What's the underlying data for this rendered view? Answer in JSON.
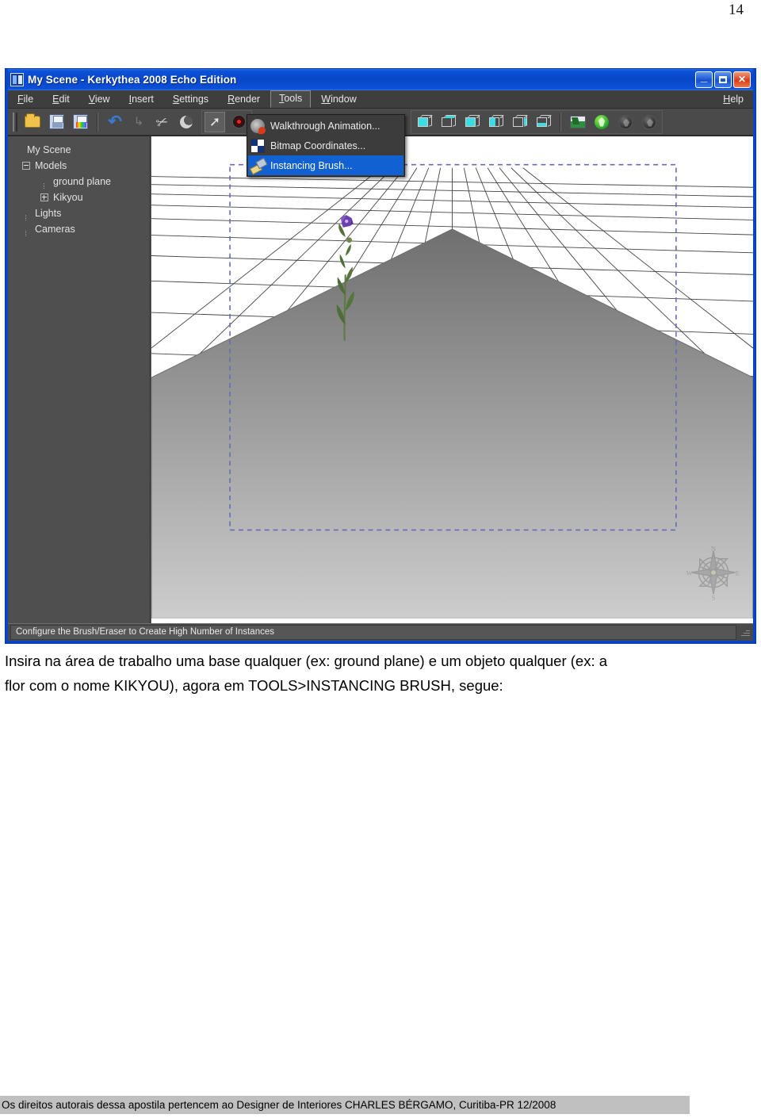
{
  "page": {
    "number": "14"
  },
  "window": {
    "title": "My Scene - Kerkythea 2008 Echo Edition",
    "app_icon": "kerkythea-icon",
    "buttons": {
      "minimize": "_",
      "maximize": "□",
      "close": "✕"
    }
  },
  "menubar": {
    "items": [
      {
        "label": "File",
        "mnemonic": "F",
        "active": false
      },
      {
        "label": "Edit",
        "mnemonic": "E",
        "active": false
      },
      {
        "label": "View",
        "mnemonic": "V",
        "active": false
      },
      {
        "label": "Insert",
        "mnemonic": "I",
        "active": false
      },
      {
        "label": "Settings",
        "mnemonic": "S",
        "active": false
      },
      {
        "label": "Render",
        "mnemonic": "R",
        "active": false
      },
      {
        "label": "Tools",
        "mnemonic": "T",
        "active": true
      },
      {
        "label": "Window",
        "mnemonic": "W",
        "active": false
      }
    ],
    "help": "Help"
  },
  "tools_menu": {
    "open": true,
    "items": [
      {
        "label": "Walkthrough Animation...",
        "icon": "walkthrough-animation-icon",
        "selected": false
      },
      {
        "label": "Bitmap Coordinates...",
        "icon": "bitmap-coordinates-icon",
        "selected": false
      },
      {
        "label": "Instancing Brush...",
        "icon": "instancing-brush-icon",
        "selected": true
      }
    ],
    "highlight_color": "#1261d2"
  },
  "toolbar": {
    "left_buttons": [
      {
        "name": "open-file-button",
        "icon": "folder-icon",
        "pressed": false
      },
      {
        "name": "save-button",
        "icon": "floppy-disk-icon",
        "pressed": false
      },
      {
        "name": "save-as-button",
        "icon": "floppy-color-icon",
        "pressed": false
      },
      {
        "name": "undo-button",
        "icon": "undo-arrow-icon",
        "pressed": false
      },
      {
        "name": "redo-button",
        "icon": "redo-arrow-icon",
        "pressed": false
      },
      {
        "name": "magic-wand-button",
        "icon": "wand-icon",
        "pressed": false
      },
      {
        "name": "material-button",
        "icon": "sphere-icon",
        "pressed": false
      },
      {
        "name": "select-tool-button",
        "icon": "cursor-arrow-icon",
        "pressed": true
      },
      {
        "name": "render-button",
        "icon": "render-target-icon",
        "pressed": false
      }
    ],
    "view_buttons": [
      {
        "name": "view-perspective-button",
        "icon": "cube-perspective-icon"
      },
      {
        "name": "view-top-button",
        "icon": "cube-top-icon"
      },
      {
        "name": "view-front-button",
        "icon": "cube-front-icon"
      },
      {
        "name": "view-back-button",
        "icon": "cube-back-icon"
      },
      {
        "name": "view-left-button",
        "icon": "cube-left-icon"
      },
      {
        "name": "view-right-button",
        "icon": "cube-right-icon"
      }
    ],
    "extra_buttons": [
      {
        "name": "image-preview-button",
        "icon": "image-icon"
      },
      {
        "name": "start-render-button",
        "icon": "green-gear-icon"
      },
      {
        "name": "globe-a-button",
        "icon": "dark-sphere-icon"
      },
      {
        "name": "globe-b-button",
        "icon": "dark-sphere-alt-icon"
      }
    ]
  },
  "sidebar": {
    "tree": [
      {
        "label": "My Scene",
        "level": 1,
        "toggle": "none",
        "name": "tree-node-my-scene"
      },
      {
        "label": "Models",
        "level": 2,
        "toggle": "minus",
        "name": "tree-node-models"
      },
      {
        "label": "ground plane",
        "level": 3,
        "toggle": "stub",
        "name": "tree-node-ground-plane"
      },
      {
        "label": "Kikyou",
        "level": 3,
        "toggle": "plus",
        "name": "tree-node-kikyou"
      },
      {
        "label": "Lights",
        "level": 2,
        "toggle": "stub",
        "name": "tree-node-lights"
      },
      {
        "label": "Cameras",
        "level": 2,
        "toggle": "stub",
        "name": "tree-node-cameras"
      }
    ]
  },
  "viewport": {
    "scene_objects": [
      "ground plane grid",
      "ground plane polygon",
      "Kikyou flower",
      "selection bounds"
    ],
    "compass": "compass-rose-watermark",
    "selection_box_color": "#6a6ab4",
    "ground_fill_color": "#8a8a8a",
    "sky_color": "#ffffff"
  },
  "status_bar": {
    "message": "Configure the Brush/Eraser to Create High Number of Instances"
  },
  "body_copy": {
    "line1": "Insira na área de trabalho uma base qualquer (ex: ground plane) e um objeto qualquer (ex: a",
    "line2": "flor com o nome KIKYOU), agora em TOOLS>INSTANCING BRUSH, segue:"
  },
  "footer": {
    "text": "Os direitos autorais dessa apostila pertencem ao Designer de Interiores CHARLES BÉRGAMO, Curitiba-PR 12/2008"
  }
}
